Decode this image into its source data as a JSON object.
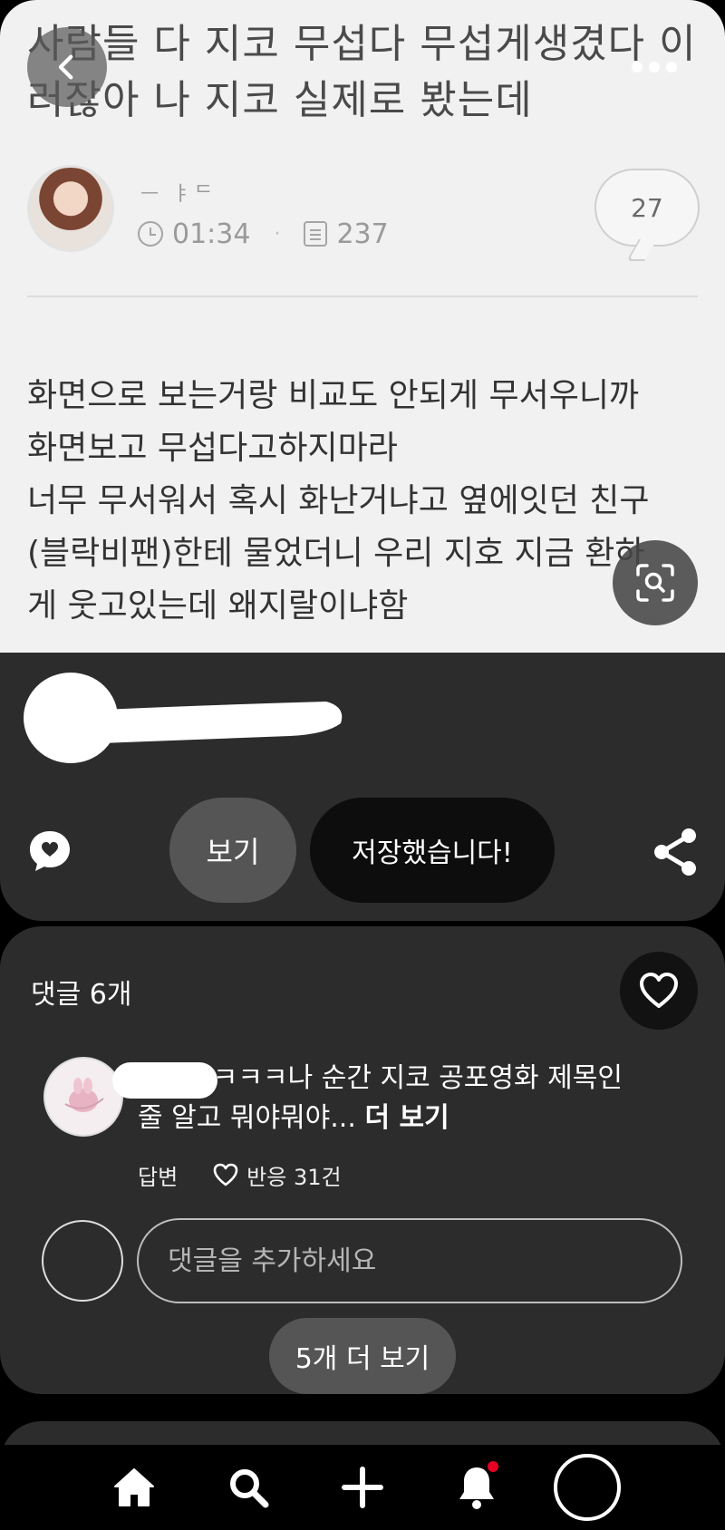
{
  "pin": {
    "title": "사람들 다 지코 무섭다 무섭게생겼다 이러잖아 나 지코 실제로 봤는데",
    "author_name": "ᅳ ㅑᄃ",
    "time": "01:34",
    "separator": "·",
    "views": "237",
    "comment_count": "27",
    "body_lines": [
      "화면으로 보는거랑 비교도 안되게 무서우니까",
      "화면보고 무섭다고하지마라",
      "너무 무서워서 혹시 화난거냐고 옆에잇던 친구",
      "(블락비팬)한테 물었더니 우리 지호 지금 환하",
      "게 웃고있는데 왜지랄이냐함"
    ],
    "icons": {
      "back": "chevron-left-icon",
      "more": "more-dots-icon",
      "lens": "visual-search-icon"
    }
  },
  "actions": {
    "view_label": "보기",
    "saved_label": "저장했습니다!",
    "icons": {
      "chat": "chat-bubble-icon",
      "share": "share-icon"
    }
  },
  "comments": {
    "header": "댓글 6개",
    "items": [
      {
        "text": "앜ㅋㅋㅋㅋㅋ나 순간 지코 공포영화 제목인줄 알고 뭐야뭐야...",
        "more": "더 보기",
        "reply_label": "답변",
        "reactions": "반응 31건"
      }
    ],
    "input_placeholder": "댓글을 추가하세요",
    "load_more": "5개 더 보기"
  },
  "nav": {
    "items": [
      "home-icon",
      "search-icon",
      "plus-icon",
      "bell-icon",
      "profile-icon"
    ],
    "notification_color": "#e60023"
  },
  "colors": {
    "panel": "#2c2c2c",
    "background": "#000000",
    "pill": "#555555",
    "saved_pill": "#0d0d0d"
  }
}
